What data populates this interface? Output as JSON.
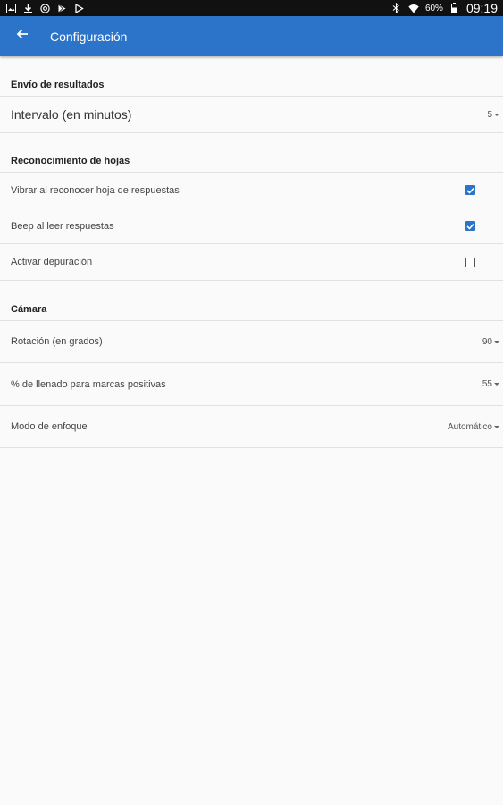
{
  "status_bar": {
    "left_icons": [
      "gallery-icon",
      "download-icon",
      "at-sign-icon",
      "play-store-icon",
      "play-icon"
    ],
    "right_icons": [
      "bluetooth-icon",
      "wifi-icon",
      "battery-icon"
    ],
    "battery": "60%",
    "time": "09:19"
  },
  "app_bar": {
    "title": "Configuración",
    "back_icon": "arrow-left-icon",
    "background_color": "#2b74c9"
  },
  "sections": [
    {
      "title": "Envío de resultados",
      "rows": [
        {
          "label": "Intervalo (en minutos)",
          "value": "5"
        }
      ]
    },
    {
      "title": "Reconocimiento de hojas",
      "rows": [
        {
          "label": "Vibrar al reconocer hoja de respuestas",
          "checked": true
        },
        {
          "label": "Beep al leer respuestas",
          "checked": true
        },
        {
          "label": "Activar depuración",
          "checked": false
        }
      ]
    },
    {
      "title": "Cámara",
      "rows": [
        {
          "label": "Rotación (en grados)",
          "value": "90"
        },
        {
          "label": "% de llenado para marcas positivas",
          "value": "55"
        },
        {
          "label": "Modo de enfoque",
          "value": "Automático"
        }
      ]
    }
  ]
}
